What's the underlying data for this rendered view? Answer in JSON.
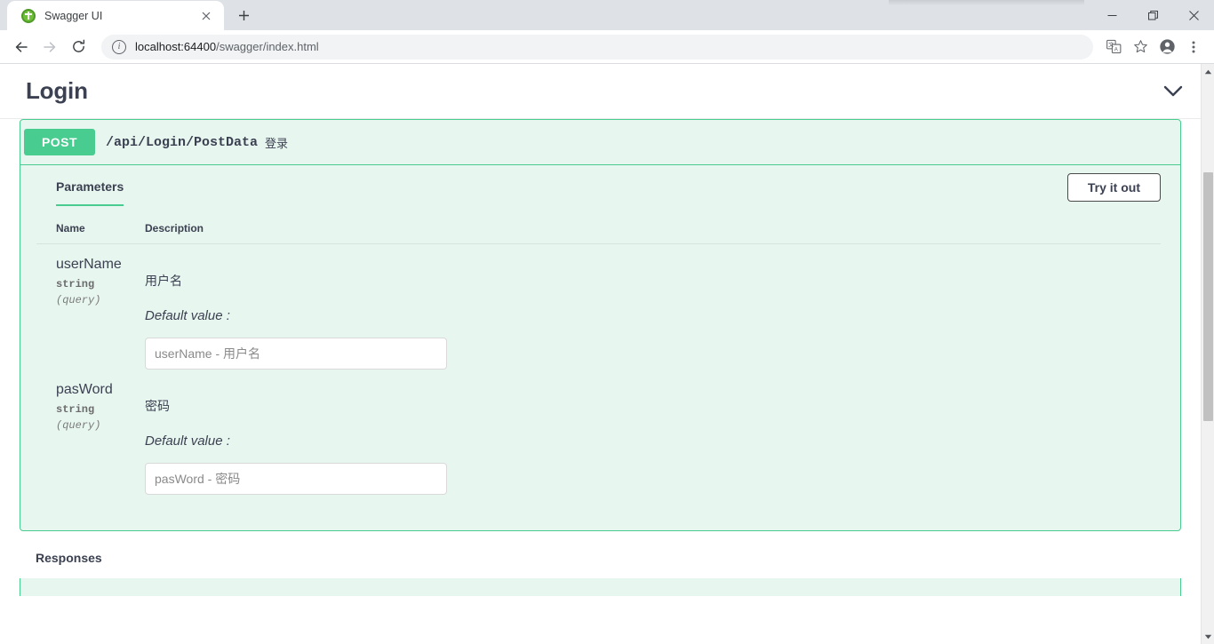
{
  "browser": {
    "tab": {
      "title": "Swagger UI",
      "favicon": "swagger-logo-icon",
      "close_icon": "close-icon"
    },
    "new_tab_icon": "plus-icon",
    "window_controls": {
      "minimize": "minimize-icon",
      "maximize": "restore-icon",
      "close": "close-icon"
    },
    "toolbar": {
      "back_icon": "back-arrow-icon",
      "forward_icon": "forward-arrow-icon",
      "reload_icon": "reload-icon",
      "site_info_icon": "info-icon",
      "url_host": "localhost:64400",
      "url_path": "/swagger/index.html",
      "translate_icon": "translate-icon",
      "bookmark_icon": "star-icon",
      "profile_icon": "account-avatar-icon",
      "menu_icon": "three-dot-menu-icon"
    }
  },
  "swagger": {
    "tag_title": "Login",
    "collapse_icon": "chevron-down-icon",
    "operation": {
      "method": "POST",
      "path": "/api/Login/PostData",
      "summary": "登录",
      "tabs": {
        "parameters_label": "Parameters"
      },
      "try_it_out_label": "Try it out",
      "table_headers": {
        "name": "Name",
        "description": "Description"
      },
      "parameters": [
        {
          "name": "userName",
          "type": "string",
          "in": "(query)",
          "description": "用户名",
          "default_label": "Default value :",
          "input_value": "",
          "input_placeholder": "userName - 用户名"
        },
        {
          "name": "pasWord",
          "type": "string",
          "in": "(query)",
          "description": "密码",
          "default_label": "Default value :",
          "input_value": "",
          "input_placeholder": "pasWord - 密码"
        }
      ],
      "responses_label": "Responses"
    }
  },
  "colors": {
    "method_green": "#49cc90",
    "block_bg": "#e8f6f0",
    "text_dark": "#3b4151"
  }
}
